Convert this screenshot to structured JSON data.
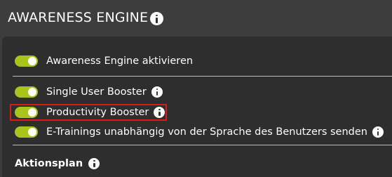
{
  "header": {
    "title": "AWARENESS ENGINE",
    "info_icon": "info-icon"
  },
  "settings": {
    "engine_toggle": {
      "label": "Awareness Engine aktivieren",
      "enabled": true
    },
    "boosters": [
      {
        "label": "Single User Booster",
        "enabled": true,
        "has_info": true
      },
      {
        "label": "Productivity Booster",
        "enabled": true,
        "has_info": true,
        "highlighted": true
      },
      {
        "label": "E-Trainings unabhängig von der Sprache des Benutzers senden",
        "enabled": true,
        "has_info": true
      }
    ]
  },
  "sections": {
    "action_plan": {
      "title": "Aktionsplan"
    }
  },
  "colors": {
    "toggle_on": "#a9c41a",
    "highlight_border": "#e01a1a",
    "panel_bg": "#2e2e2e",
    "header_bg": "#3d3d3d"
  }
}
